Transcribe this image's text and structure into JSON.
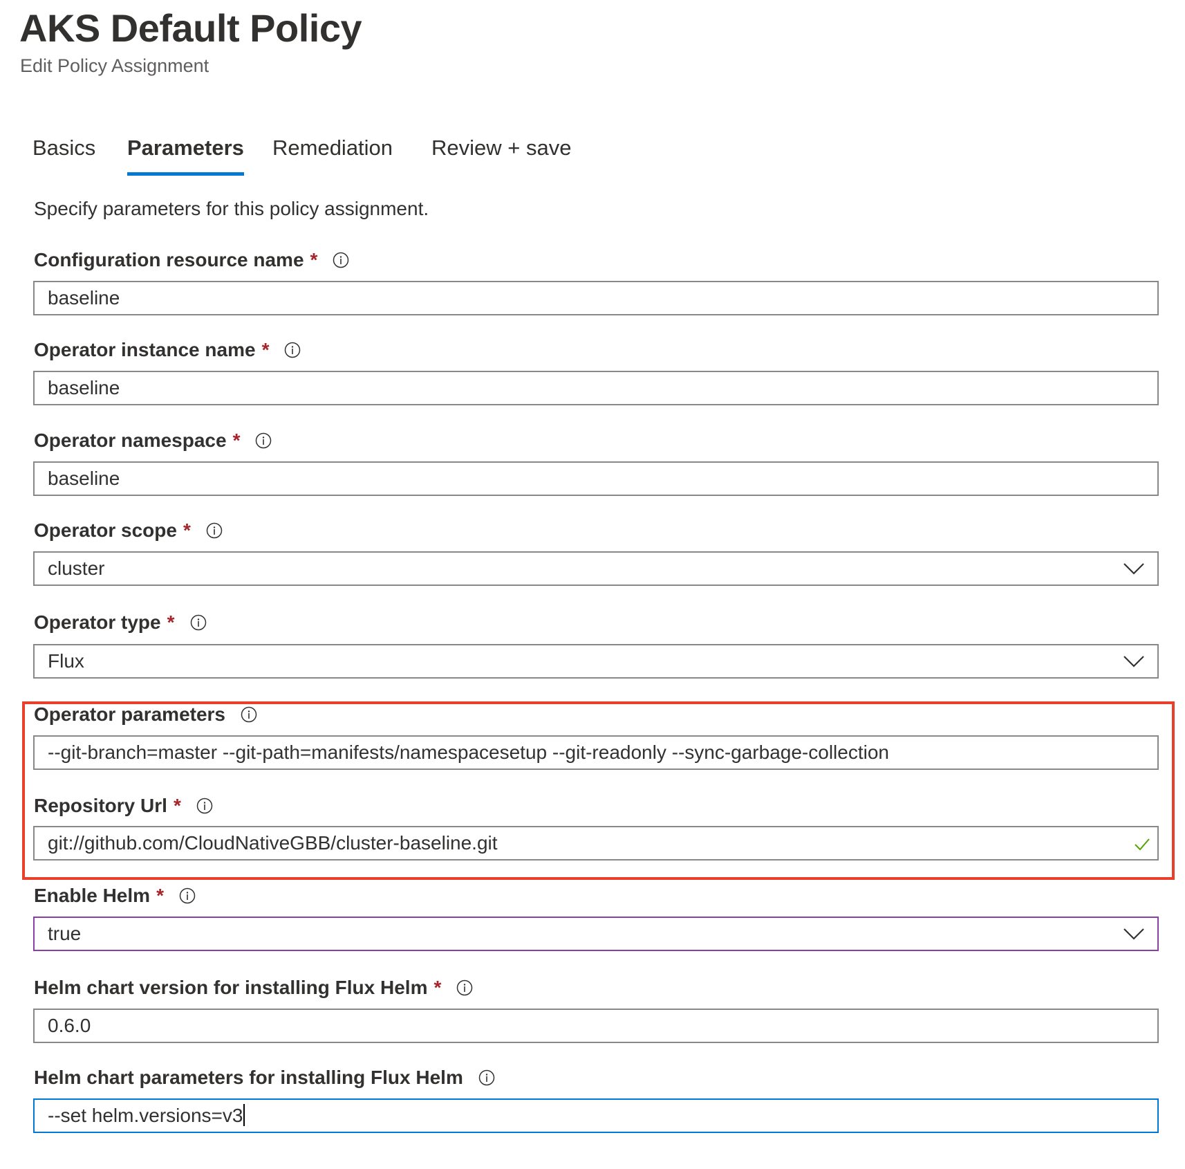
{
  "header": {
    "title": "AKS Default Policy",
    "subtitle": "Edit Policy Assignment"
  },
  "tabs": [
    {
      "label": "Basics",
      "active": false
    },
    {
      "label": "Parameters",
      "active": true
    },
    {
      "label": "Remediation",
      "active": false
    },
    {
      "label": "Review + save",
      "active": false
    }
  ],
  "intro_text": "Specify parameters for this policy assignment.",
  "required_marker": "*",
  "fields": [
    {
      "label": "Configuration resource name",
      "required": true,
      "type": "text",
      "value": "baseline"
    },
    {
      "label": "Operator instance name",
      "required": true,
      "type": "text",
      "value": "baseline"
    },
    {
      "label": "Operator namespace",
      "required": true,
      "type": "text",
      "value": "baseline"
    },
    {
      "label": "Operator scope",
      "required": true,
      "type": "dropdown",
      "value": "cluster"
    },
    {
      "label": "Operator type",
      "required": true,
      "type": "dropdown",
      "value": "Flux"
    },
    {
      "label": "Operator parameters",
      "required": false,
      "type": "text",
      "value": "--git-branch=master --git-path=manifests/namespacesetup --git-readonly --sync-garbage-collection"
    },
    {
      "label": "Repository Url",
      "required": true,
      "type": "text",
      "value": "git://github.com/CloudNativeGBB/cluster-baseline.git",
      "validated": true
    },
    {
      "label": "Enable Helm",
      "required": true,
      "type": "dropdown",
      "value": "true"
    },
    {
      "label": "Helm chart version for installing Flux Helm",
      "required": true,
      "type": "text",
      "value": "0.6.0"
    },
    {
      "label": "Helm chart parameters for installing Flux Helm",
      "required": false,
      "type": "text",
      "value": "--set helm.versions=v3",
      "focused": true
    }
  ],
  "colors": {
    "accent": "#0078d4",
    "required": "#a4262c",
    "highlight": "#e8402a",
    "valid_check": "#57a300",
    "dropdown_focus": "#8a3ea8"
  }
}
